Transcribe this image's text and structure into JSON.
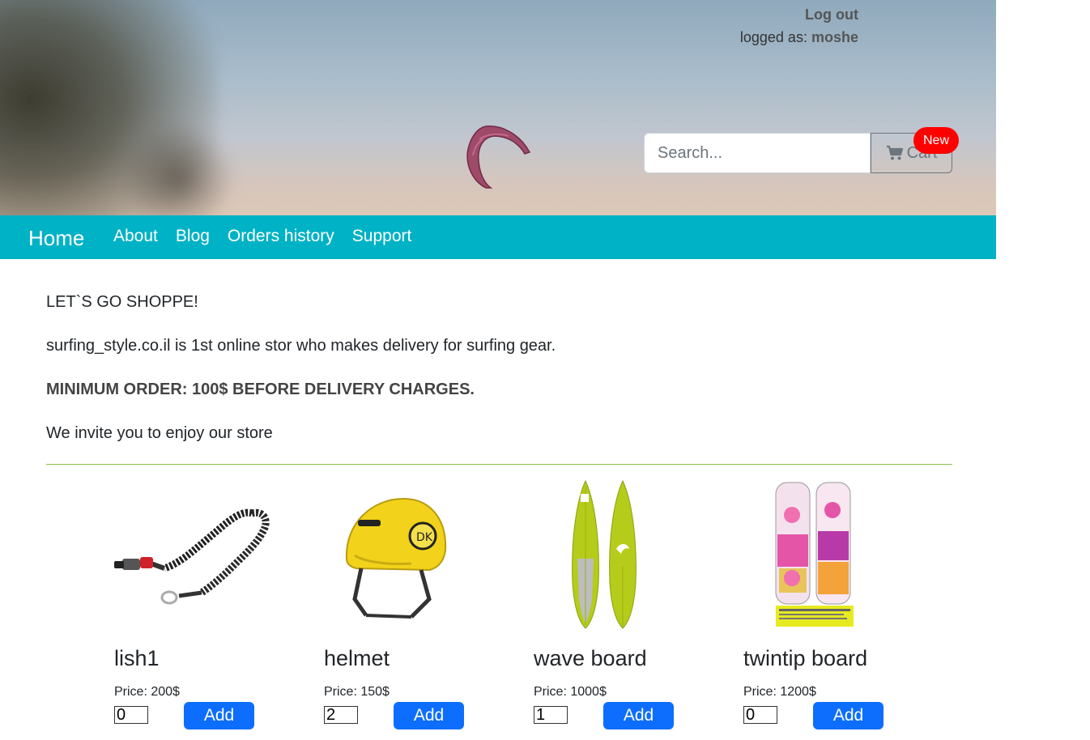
{
  "header": {
    "logout_label": "Log out",
    "logged_as_prefix": "logged as:",
    "username": "moshe",
    "search_placeholder": "Search...",
    "cart_label": "Cart",
    "cart_badge": "New"
  },
  "nav": {
    "brand": "Home",
    "links": [
      "About",
      "Blog",
      "Orders history",
      "Support"
    ]
  },
  "intro": {
    "line1": "LET`S GO SHOPPE!",
    "line2": "surfing_style.co.il is 1st online stor who makes delivery for surfing gear.",
    "line3": "MINIMUM ORDER: 100$ BEFORE DELIVERY CHARGES.",
    "line4": "We invite you to enjoy our store"
  },
  "products": [
    {
      "name": "lish1",
      "price": "Price: 200$",
      "qty": "0",
      "add_label": "Add"
    },
    {
      "name": "helmet",
      "price": "Price: 150$",
      "qty": "2",
      "add_label": "Add"
    },
    {
      "name": "wave board",
      "price": "Price: 1000$",
      "qty": "1",
      "add_label": "Add"
    },
    {
      "name": "twintip board",
      "price": "Price: 1200$",
      "qty": "0",
      "add_label": "Add"
    }
  ],
  "colors": {
    "navbar": "#00b2c5",
    "add_button": "#0d6efd",
    "badge": "#ff0000",
    "divider": "#8bc34a"
  }
}
